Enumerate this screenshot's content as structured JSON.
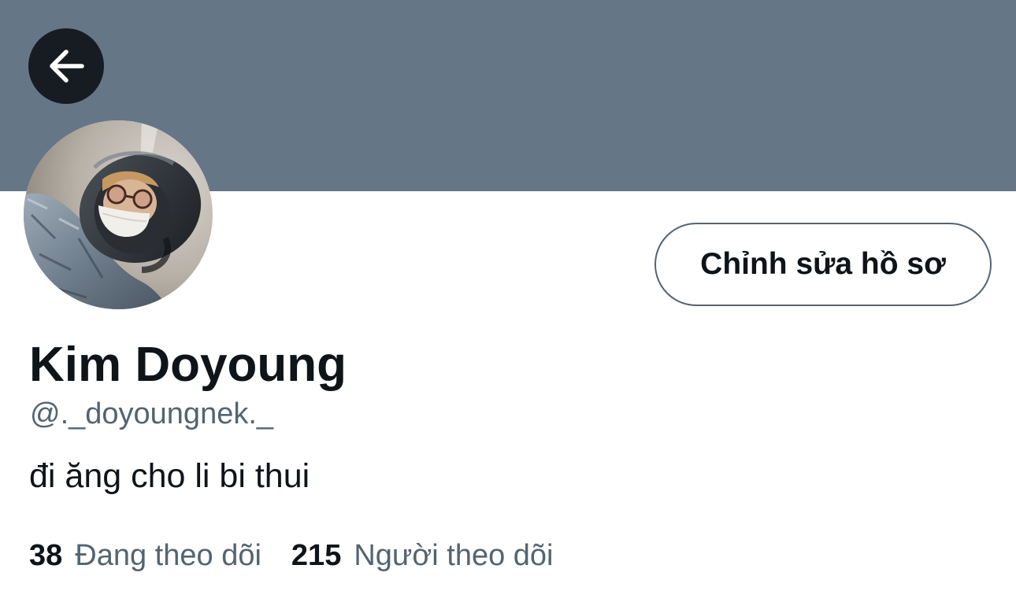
{
  "header": {
    "banner_color": "#657687",
    "back_icon": "arrow-left-icon"
  },
  "profile": {
    "display_name": "Kim Doyoung",
    "handle": "@._doyoungnek._",
    "bio": "đi ăng cho li bi thui",
    "edit_button_label": "Chỉnh sửa hồ sơ"
  },
  "stats": {
    "following_count": "38",
    "following_label": "Đang theo dõi",
    "followers_count": "215",
    "followers_label": "Người theo dõi"
  },
  "colors": {
    "text_primary": "#0f1419",
    "text_secondary": "#536471",
    "back_button_bg": "#161c22"
  }
}
